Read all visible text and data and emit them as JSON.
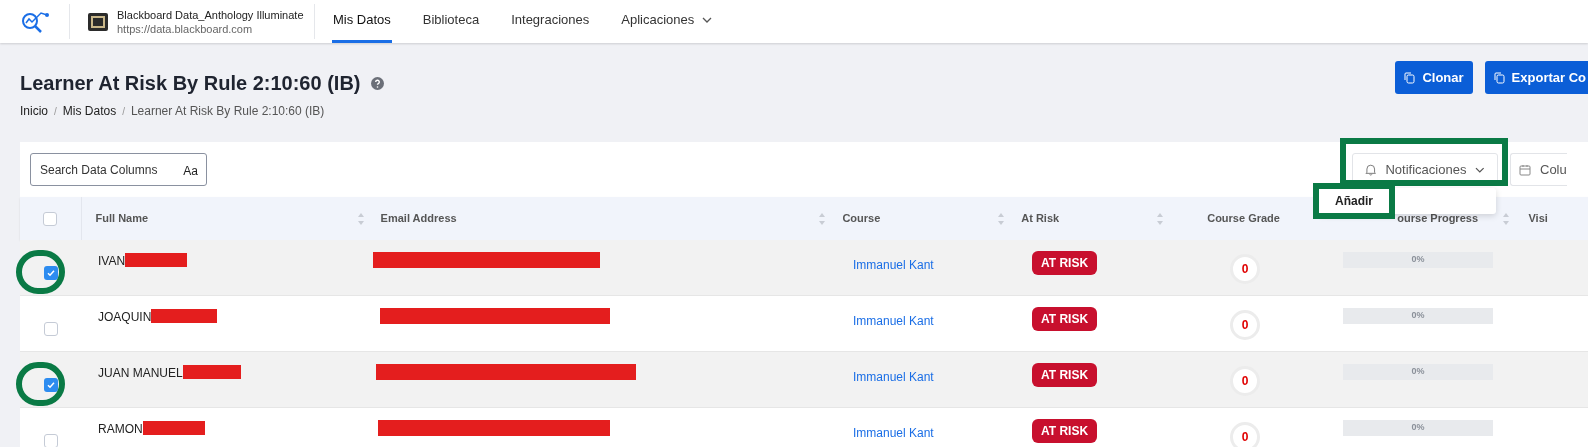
{
  "header": {
    "org": {
      "name": "Blackboard Data_Anthology Illuminate",
      "url": "https://data.blackboard.com"
    },
    "nav_tabs": [
      {
        "label": "Mis Datos",
        "selected": true,
        "kind": "link"
      },
      {
        "label": "Biblioteca",
        "selected": false,
        "kind": "link"
      },
      {
        "label": "Integraciones",
        "selected": false,
        "kind": "link"
      },
      {
        "label": "Aplicaciones",
        "selected": false,
        "kind": "menu"
      }
    ]
  },
  "page": {
    "title": "Learner At Risk By Rule 2:10:60 (IB)",
    "breadcrumb": {
      "separator": "/",
      "items": [
        "Inicio",
        "Mis Datos",
        "Learner At Risk By Rule 2:10:60 (IB)"
      ]
    },
    "buttons": [
      "Clonar",
      "Exportar Co"
    ]
  },
  "toolbar": {
    "search": {
      "placeholder": "Search Data Columns",
      "hint": "Aa"
    },
    "notifications": {
      "label": "Notificaciones",
      "menu": [
        "Añadir"
      ]
    },
    "columns_button": "Colu"
  },
  "table": {
    "select_all": {
      "checked": false
    },
    "columns": [
      {
        "label": "Full Name",
        "sortable": true
      },
      {
        "label": "Email Address",
        "sortable": true
      },
      {
        "label": "Course",
        "sortable": true
      },
      {
        "label": "At Risk",
        "sortable": true
      },
      {
        "label": "Course Grade",
        "sortable": false
      },
      {
        "label": "ourse Progress",
        "sortable": true
      },
      {
        "label": "Visi",
        "sortable": false
      }
    ],
    "rows": [
      {
        "selected": true,
        "name": "IVAN",
        "course": "Immanuel Kant",
        "status": "AT RISK",
        "grade": "0",
        "progress": {
          "level": 0,
          "reading": "0%"
        }
      },
      {
        "selected": false,
        "name": "JOAQUIN",
        "course": "Immanuel Kant",
        "status": "AT RISK",
        "grade": "0",
        "progress": {
          "level": 0,
          "reading": "0%"
        }
      },
      {
        "selected": true,
        "name": "JUAN MANUEL",
        "course": "Immanuel Kant",
        "status": "AT RISK",
        "grade": "0",
        "progress": {
          "level": 0,
          "reading": "0%"
        }
      },
      {
        "selected": false,
        "name": "RAMON",
        "course": "Immanuel Kant",
        "status": "AT RISK",
        "grade": "0",
        "progress": {
          "level": 0,
          "reading": "0%"
        }
      }
    ]
  }
}
